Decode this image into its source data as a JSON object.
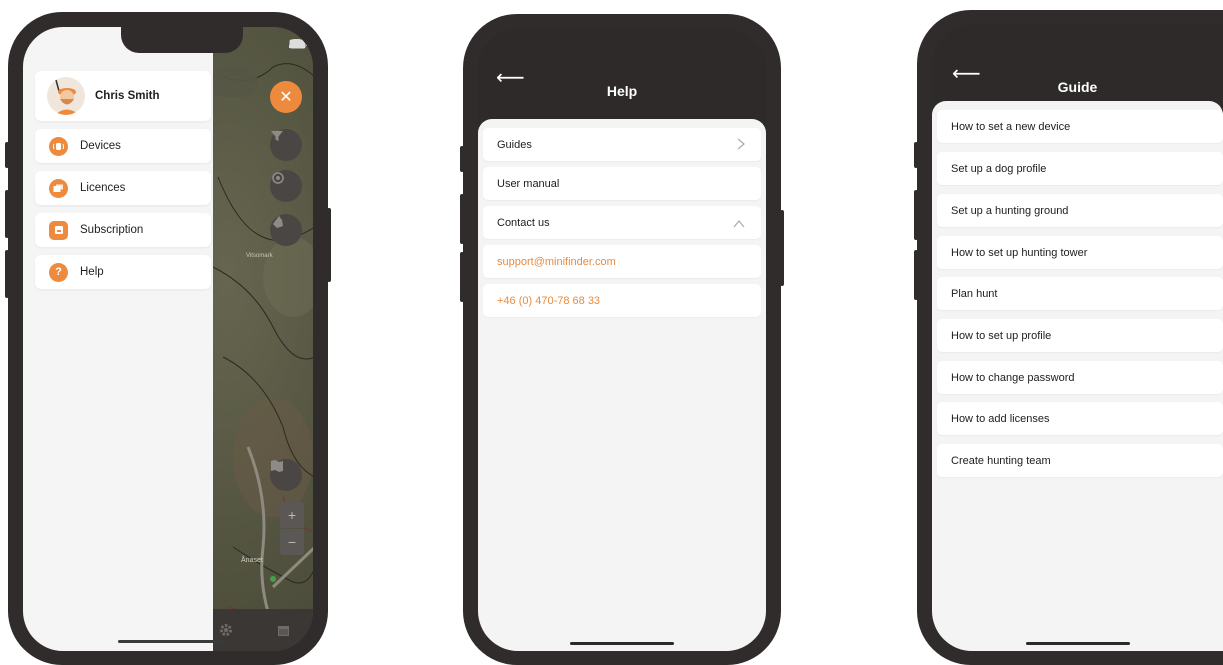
{
  "screen1": {
    "user_name": "Chris Smith",
    "menu": [
      {
        "label": "Devices",
        "icon": "devices-icon"
      },
      {
        "label": "Licences",
        "icon": "licences-icon"
      },
      {
        "label": "Subscription",
        "icon": "subscription-icon"
      },
      {
        "label": "Help",
        "icon": "help-icon"
      }
    ],
    "map_labels": [
      "Vitsomark",
      "Ånaset"
    ],
    "zoom_in": "+",
    "zoom_out": "−"
  },
  "screen2": {
    "title": "Help",
    "items": [
      {
        "label": "Guides"
      },
      {
        "label": "User manual"
      },
      {
        "label": "Contact us"
      }
    ],
    "email": "support@minifinder.com",
    "phone": "+46 (0) 470-78 68 33"
  },
  "screen3": {
    "title": "Guide",
    "items": [
      "How to set a new device",
      "Set up a dog profile",
      "Set up a hunting ground",
      "How to set up hunting tower",
      "Plan hunt",
      "How to set up profile",
      "How to change password",
      "How to add licenses",
      "Create hunting team"
    ]
  },
  "colors": {
    "accent": "#ee8a3e",
    "frame": "#2f2c2b",
    "content_bg": "#f4f4f4"
  }
}
